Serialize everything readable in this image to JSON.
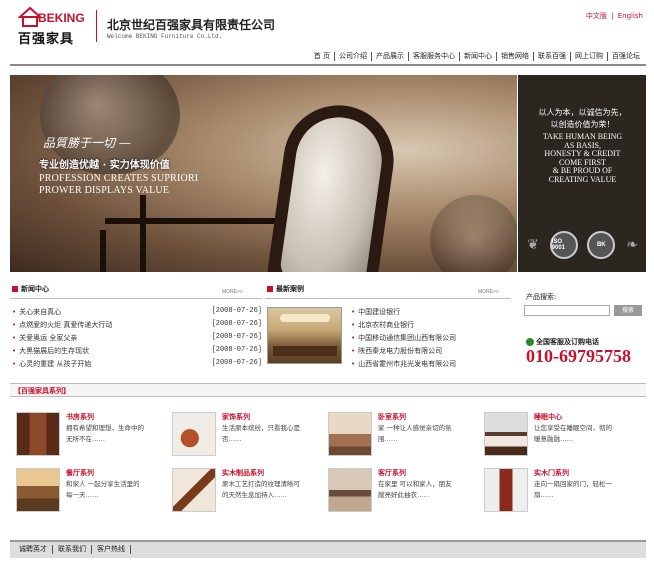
{
  "header": {
    "logo_en": "BEKING",
    "logo_cn": "百强家具",
    "company_cn": "北京世纪百强家具有限责任公司",
    "company_en": "Welcome BEKING Furniture Co.Ltd.",
    "lang_cn": "中文版",
    "lang_sep": "|",
    "lang_en": "English",
    "nav": [
      "首 页",
      "公司介绍",
      "产品展示",
      "客服服务中心",
      "新闻中心",
      "销售网络",
      "联系百强",
      "网上订购",
      "百强论坛"
    ]
  },
  "banner": {
    "line1": "品質勝于一切 —",
    "line2": "专业创造优越 · 实力体现价值",
    "line3": "PROFESSION CREATES SUPRIORI",
    "line4": "PROWER DISPLAYS VALUE"
  },
  "slogan": {
    "cn1": "以人为本，以诚信为先，",
    "cn2": "以创造价值为荣！",
    "en": [
      "TAKE HUMAN BEING",
      "AS BASIS,",
      "HONESTY & CREDIT",
      "COME FIRST",
      "& BE PROUD OF",
      "CREATING VALUE"
    ],
    "badge1": "ISO 9001",
    "badge2": "BK"
  },
  "news": {
    "title": "新闻中心",
    "more": "MORE>>",
    "items": [
      {
        "text": "关心来自真心",
        "date": "[2008-07-26]"
      },
      {
        "text": "点燃爱的火炬 真爱传递大行动",
        "date": "[2008-07-26]"
      },
      {
        "text": "关爱奥运 全家父亲",
        "date": "[2008-07-26]"
      },
      {
        "text": "大黑猫展后的生存现状",
        "date": "[2008-07-26]"
      },
      {
        "text": "心灵的重建 从孩子开始",
        "date": "[2008-07-26]"
      }
    ]
  },
  "cases": {
    "title": "最新案例",
    "more": "MORE>>",
    "items": [
      "中国建设银行",
      "北京农村商业银行",
      "中国移动通信集团山西有限公司",
      "陕西秦龙电力股份有限公司",
      "山西省霍州市兆光发电有限公司"
    ]
  },
  "search": {
    "label": "产品搜索:",
    "placeholder": "",
    "button": "搜索"
  },
  "hotline": {
    "label": "全国客服及订购电话",
    "number": "010-69795758"
  },
  "products": {
    "title": "百强家具系列",
    "items": [
      {
        "name": "书房系列",
        "desc": "拥有希望和理想，生命中的无所不在……"
      },
      {
        "name": "家饰系列",
        "desc": "生活原本缤纷，只看我心是否……"
      },
      {
        "name": "卧室系列",
        "desc": "家 一种让人感觉亲切的氛围……"
      },
      {
        "name": "睡眠中心",
        "desc": "让您享受在睡眠空间，彻的暖意融融……"
      },
      {
        "name": "餐厅系列",
        "desc": "和家人 一起分享生活里的每一天……"
      },
      {
        "name": "实木制品系列",
        "desc": "原木工艺打造的纹理清晰可的天然生息加持入……"
      },
      {
        "name": "客厅系列",
        "desc": "在家里 可以和家人，朋友敞亮好此抽衣……"
      },
      {
        "name": "实木门系列",
        "desc": "走向一扇回家的门，轻松一扇……"
      }
    ]
  },
  "footer": {
    "links": [
      "诚聘英才",
      "联系我们",
      "客户热线"
    ]
  },
  "colors": {
    "accent": "#c8102e",
    "slogan_bg": "#2b2620"
  }
}
